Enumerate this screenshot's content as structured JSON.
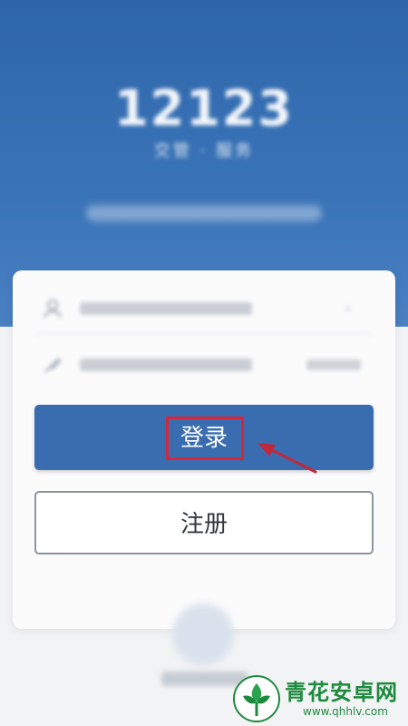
{
  "header": {
    "app_name": "12123",
    "subtitle": "交管 · 服务",
    "background_color": "#3a74b8"
  },
  "form": {
    "account_field": {
      "icon": "user-icon"
    },
    "password_field": {
      "icon": "lock-icon"
    }
  },
  "actions": {
    "login_label": "登录",
    "register_label": "注册",
    "login_color": "#3a6db0",
    "highlight_color": "#d7263a"
  },
  "watermark": {
    "name": "青花安卓网",
    "url": "www.qhhlv.com"
  }
}
